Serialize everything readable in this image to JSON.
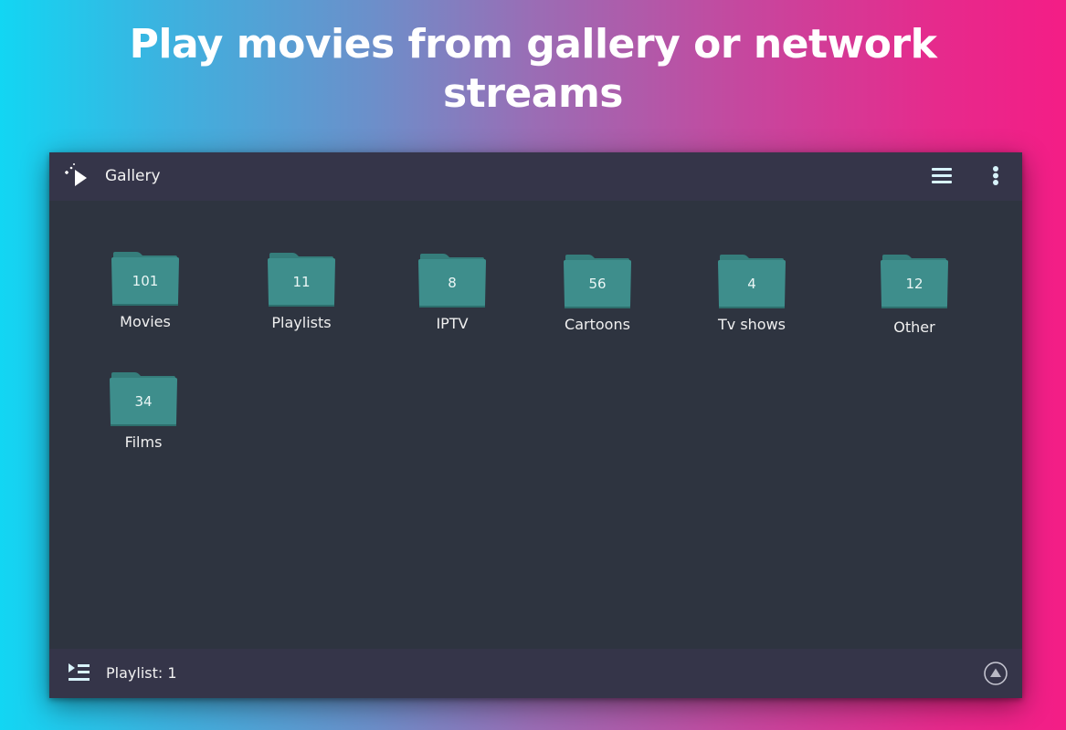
{
  "promo": {
    "headline_line1": "Play movies from gallery or network",
    "headline_line2": "streams"
  },
  "app": {
    "title": "Gallery",
    "logo_icon": "play-sparkle-icon",
    "actions": [
      {
        "name": "list-view",
        "icon": "hamburger-list-icon"
      },
      {
        "name": "more-options",
        "icon": "vertical-dots-icon"
      }
    ]
  },
  "folders": [
    {
      "label": "Movies",
      "count": "101"
    },
    {
      "label": "Playlists",
      "count": "11"
    },
    {
      "label": "IPTV",
      "count": "8"
    },
    {
      "label": "Cartoons",
      "count": "56"
    },
    {
      "label": "Tv shows",
      "count": "4"
    },
    {
      "label": "Other",
      "count": "12"
    },
    {
      "label": "Films",
      "count": "34"
    }
  ],
  "bottom_bar": {
    "playlist_label": "Playlist: 1",
    "playlist_icon": "playlist-queue-icon",
    "expand_icon": "chevron-up-circle-icon"
  },
  "colors": {
    "folder": "#3e8e8c",
    "bar_background": "#353549",
    "content_background": "#2e3440",
    "icon_tint": "#d8f3fb"
  }
}
